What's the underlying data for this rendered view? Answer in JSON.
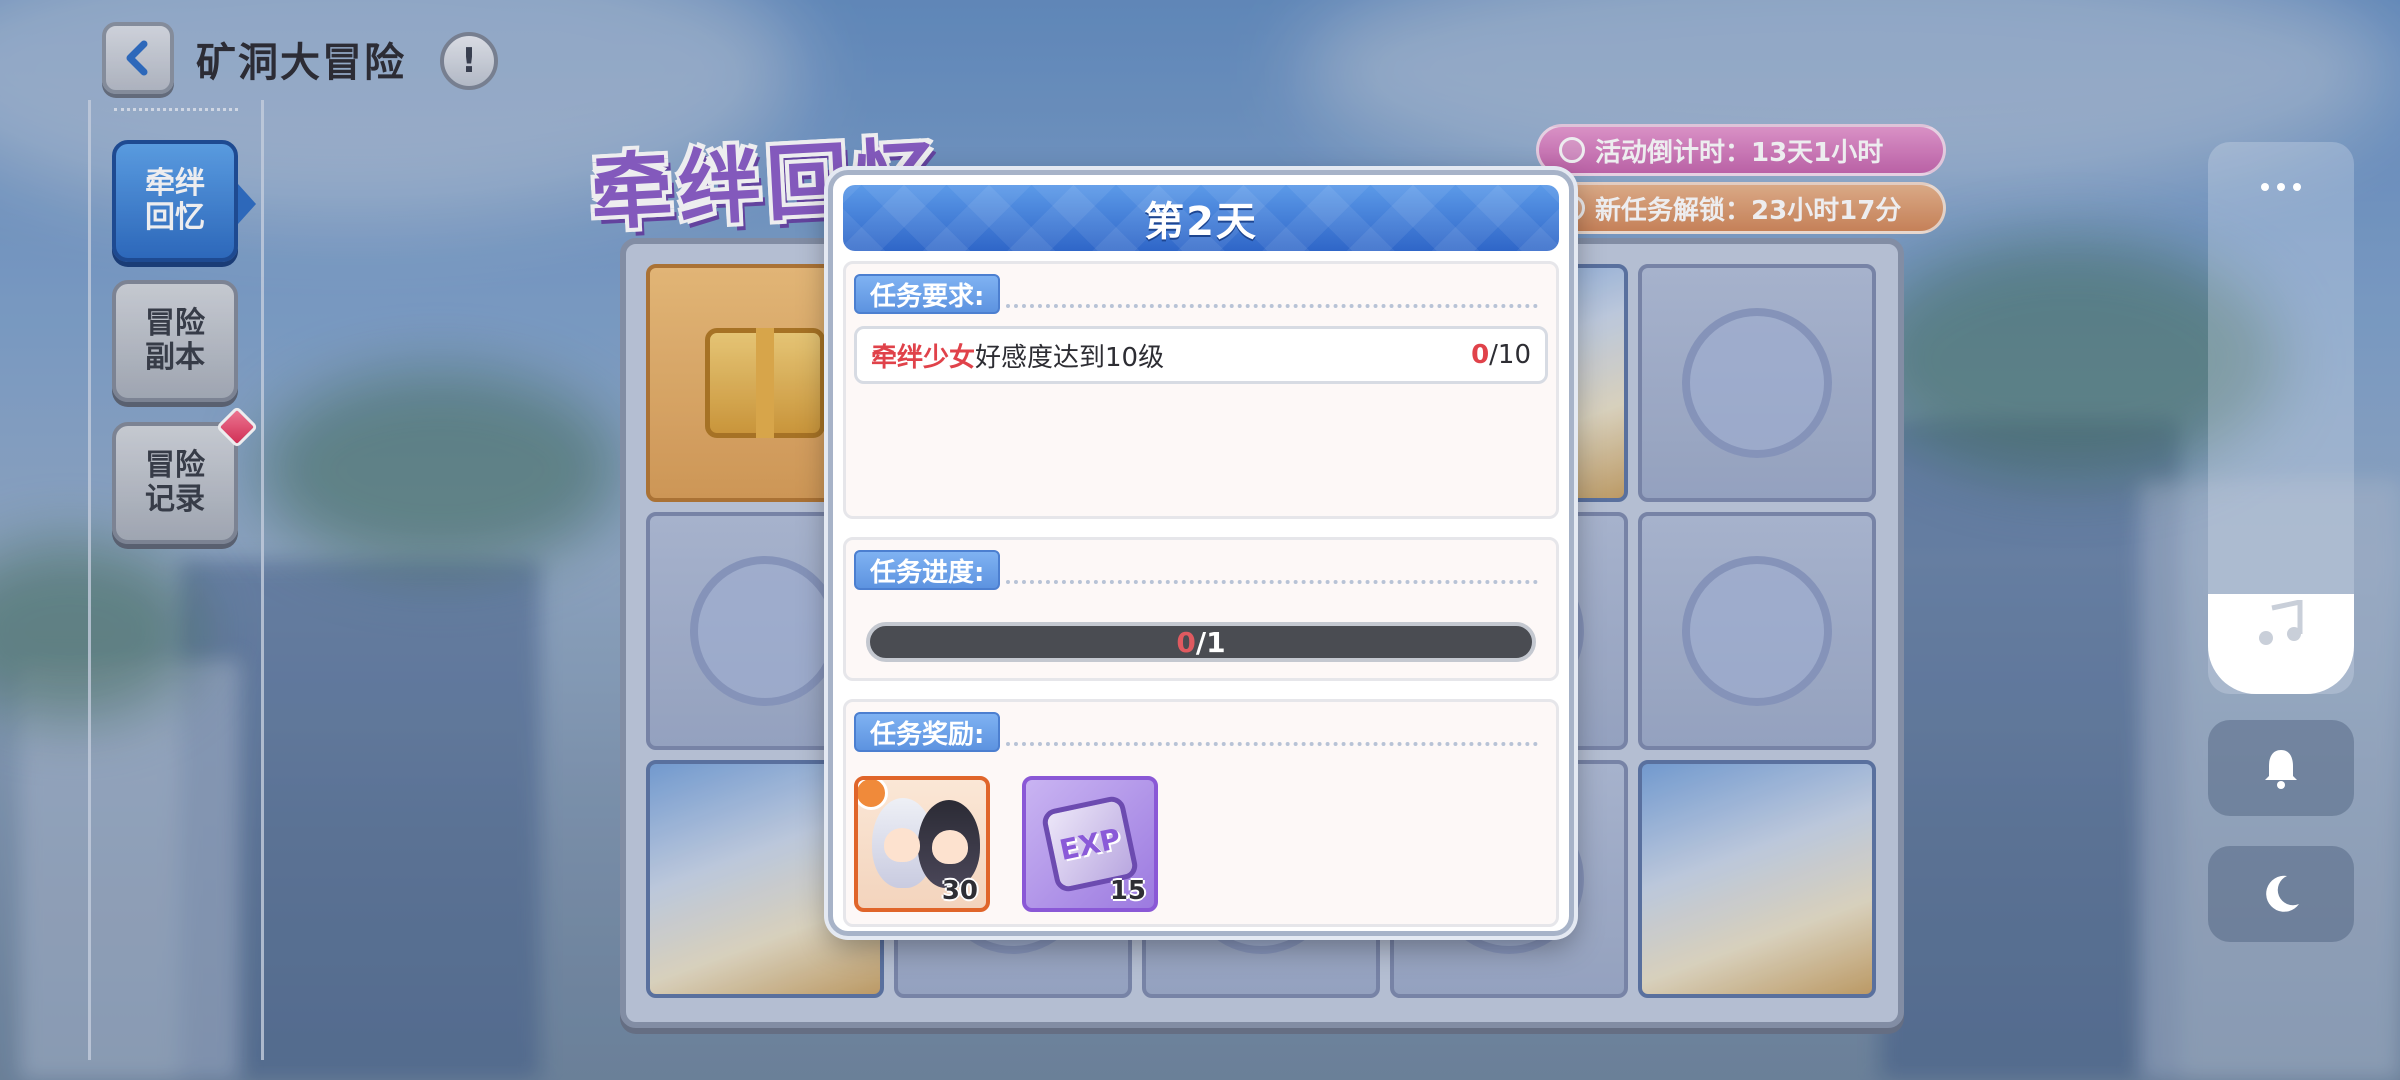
{
  "header": {
    "title": "矿洞大冒险",
    "back_icon": "chevron-left-icon",
    "info_icon": "exclamation-icon",
    "info_glyph": "!"
  },
  "side_menu": {
    "items": [
      {
        "line1": "牵绊",
        "line2": "回忆",
        "active": true
      },
      {
        "line1": "冒险",
        "line2": "副本",
        "active": false
      },
      {
        "line1": "冒险",
        "line2": "记录",
        "active": false,
        "badge": true
      }
    ]
  },
  "event": {
    "banner_text": "牵绊回忆",
    "countdown": "活动倒计时：13天1小时",
    "unlock": "新任务解锁：23小时17分"
  },
  "modal": {
    "title": "第2天",
    "requirement": {
      "label": "任务要求:",
      "task_highlight": "牵绊少女",
      "task_text": "好感度达到10级",
      "count_current": "0",
      "count_total": "/10"
    },
    "progress": {
      "label": "任务进度:",
      "current": "0",
      "total": "/1",
      "fraction": 0
    },
    "reward": {
      "label": "任务奖励:",
      "items": [
        {
          "name": "character-shard",
          "quantity": "30"
        },
        {
          "name": "exp-item",
          "icon_text": "EXP",
          "quantity": "15"
        }
      ]
    }
  },
  "colors": {
    "accent_blue": "#2f66c8",
    "highlight_red": "#e0424a",
    "countdown_pink": "#c868b0",
    "unlock_orange": "#d48a5c"
  }
}
